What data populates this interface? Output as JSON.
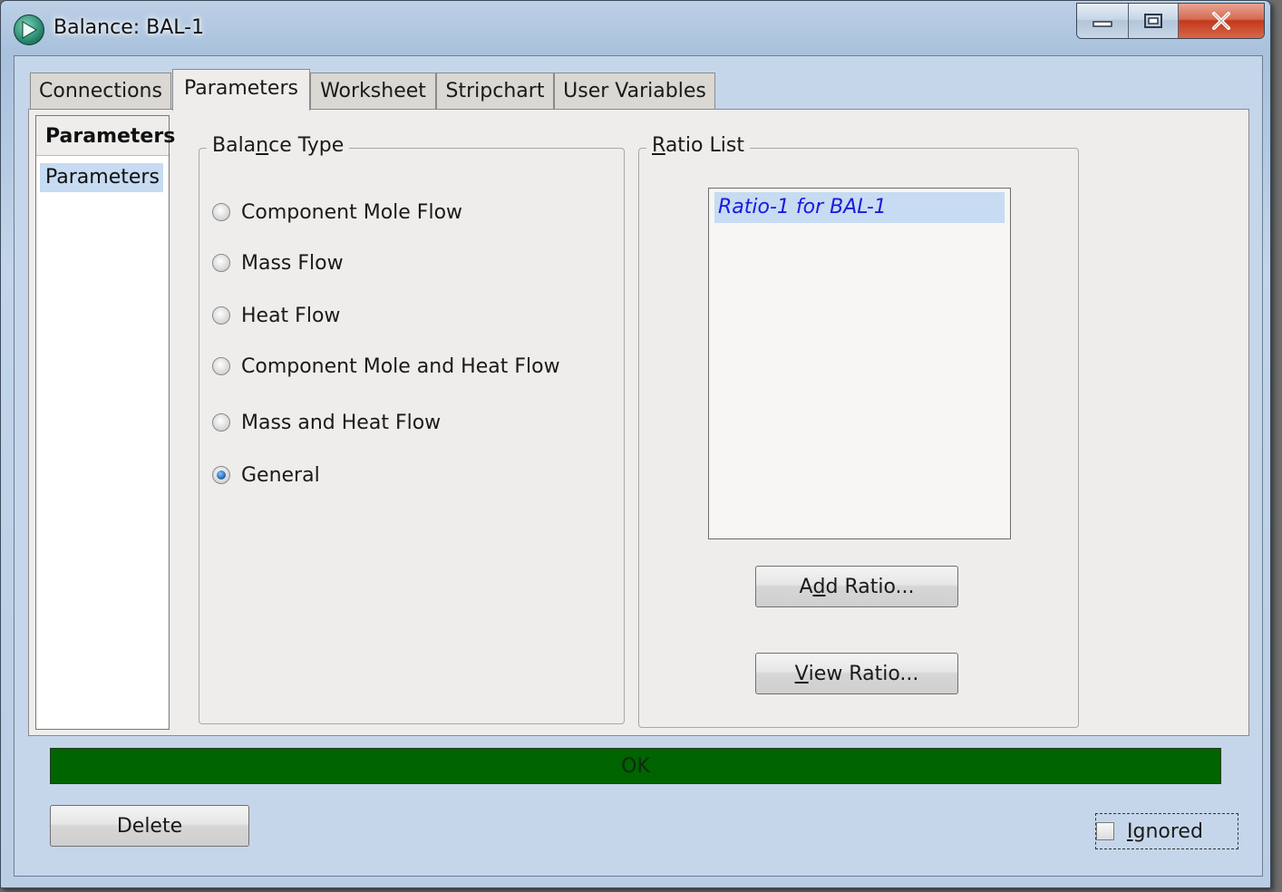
{
  "window": {
    "title": "Balance: BAL-1"
  },
  "tabs": [
    {
      "label": "Connections",
      "active": false
    },
    {
      "label": "Parameters",
      "active": true
    },
    {
      "label": "Worksheet",
      "active": false
    },
    {
      "label": "Stripchart",
      "active": false
    },
    {
      "label": "User Variables",
      "active": false
    }
  ],
  "left_nav": {
    "header": "Parameters",
    "items": [
      "Parameters"
    ],
    "selected": "Parameters"
  },
  "balance_type": {
    "legend_before": "Bala",
    "legend_mnemonic": "n",
    "legend_after": "ce Type",
    "options": [
      "Component Mole Flow",
      "Mass Flow",
      "Heat Flow",
      "Component Mole and Heat Flow",
      "Mass and Heat Flow",
      "General"
    ],
    "selected": "General"
  },
  "ratio_list": {
    "legend_before": "",
    "legend_mnemonic": "R",
    "legend_after": "atio List",
    "items": [
      "Ratio-1 for BAL-1"
    ],
    "add_button": {
      "before": "A",
      "mnemonic": "d",
      "after": "d Ratio..."
    },
    "view_button": {
      "before": "",
      "mnemonic": "V",
      "after": "iew Ratio..."
    }
  },
  "status": {
    "text": "OK",
    "color": "#006400"
  },
  "footer": {
    "delete_label": "Delete",
    "ignored_mnemonic": "I",
    "ignored_after": "gnored",
    "ignored_checked": false
  },
  "colors": {
    "selection": "#c7dbf2",
    "list_text": "#1a1ae0",
    "close_button": "#c1391c"
  }
}
